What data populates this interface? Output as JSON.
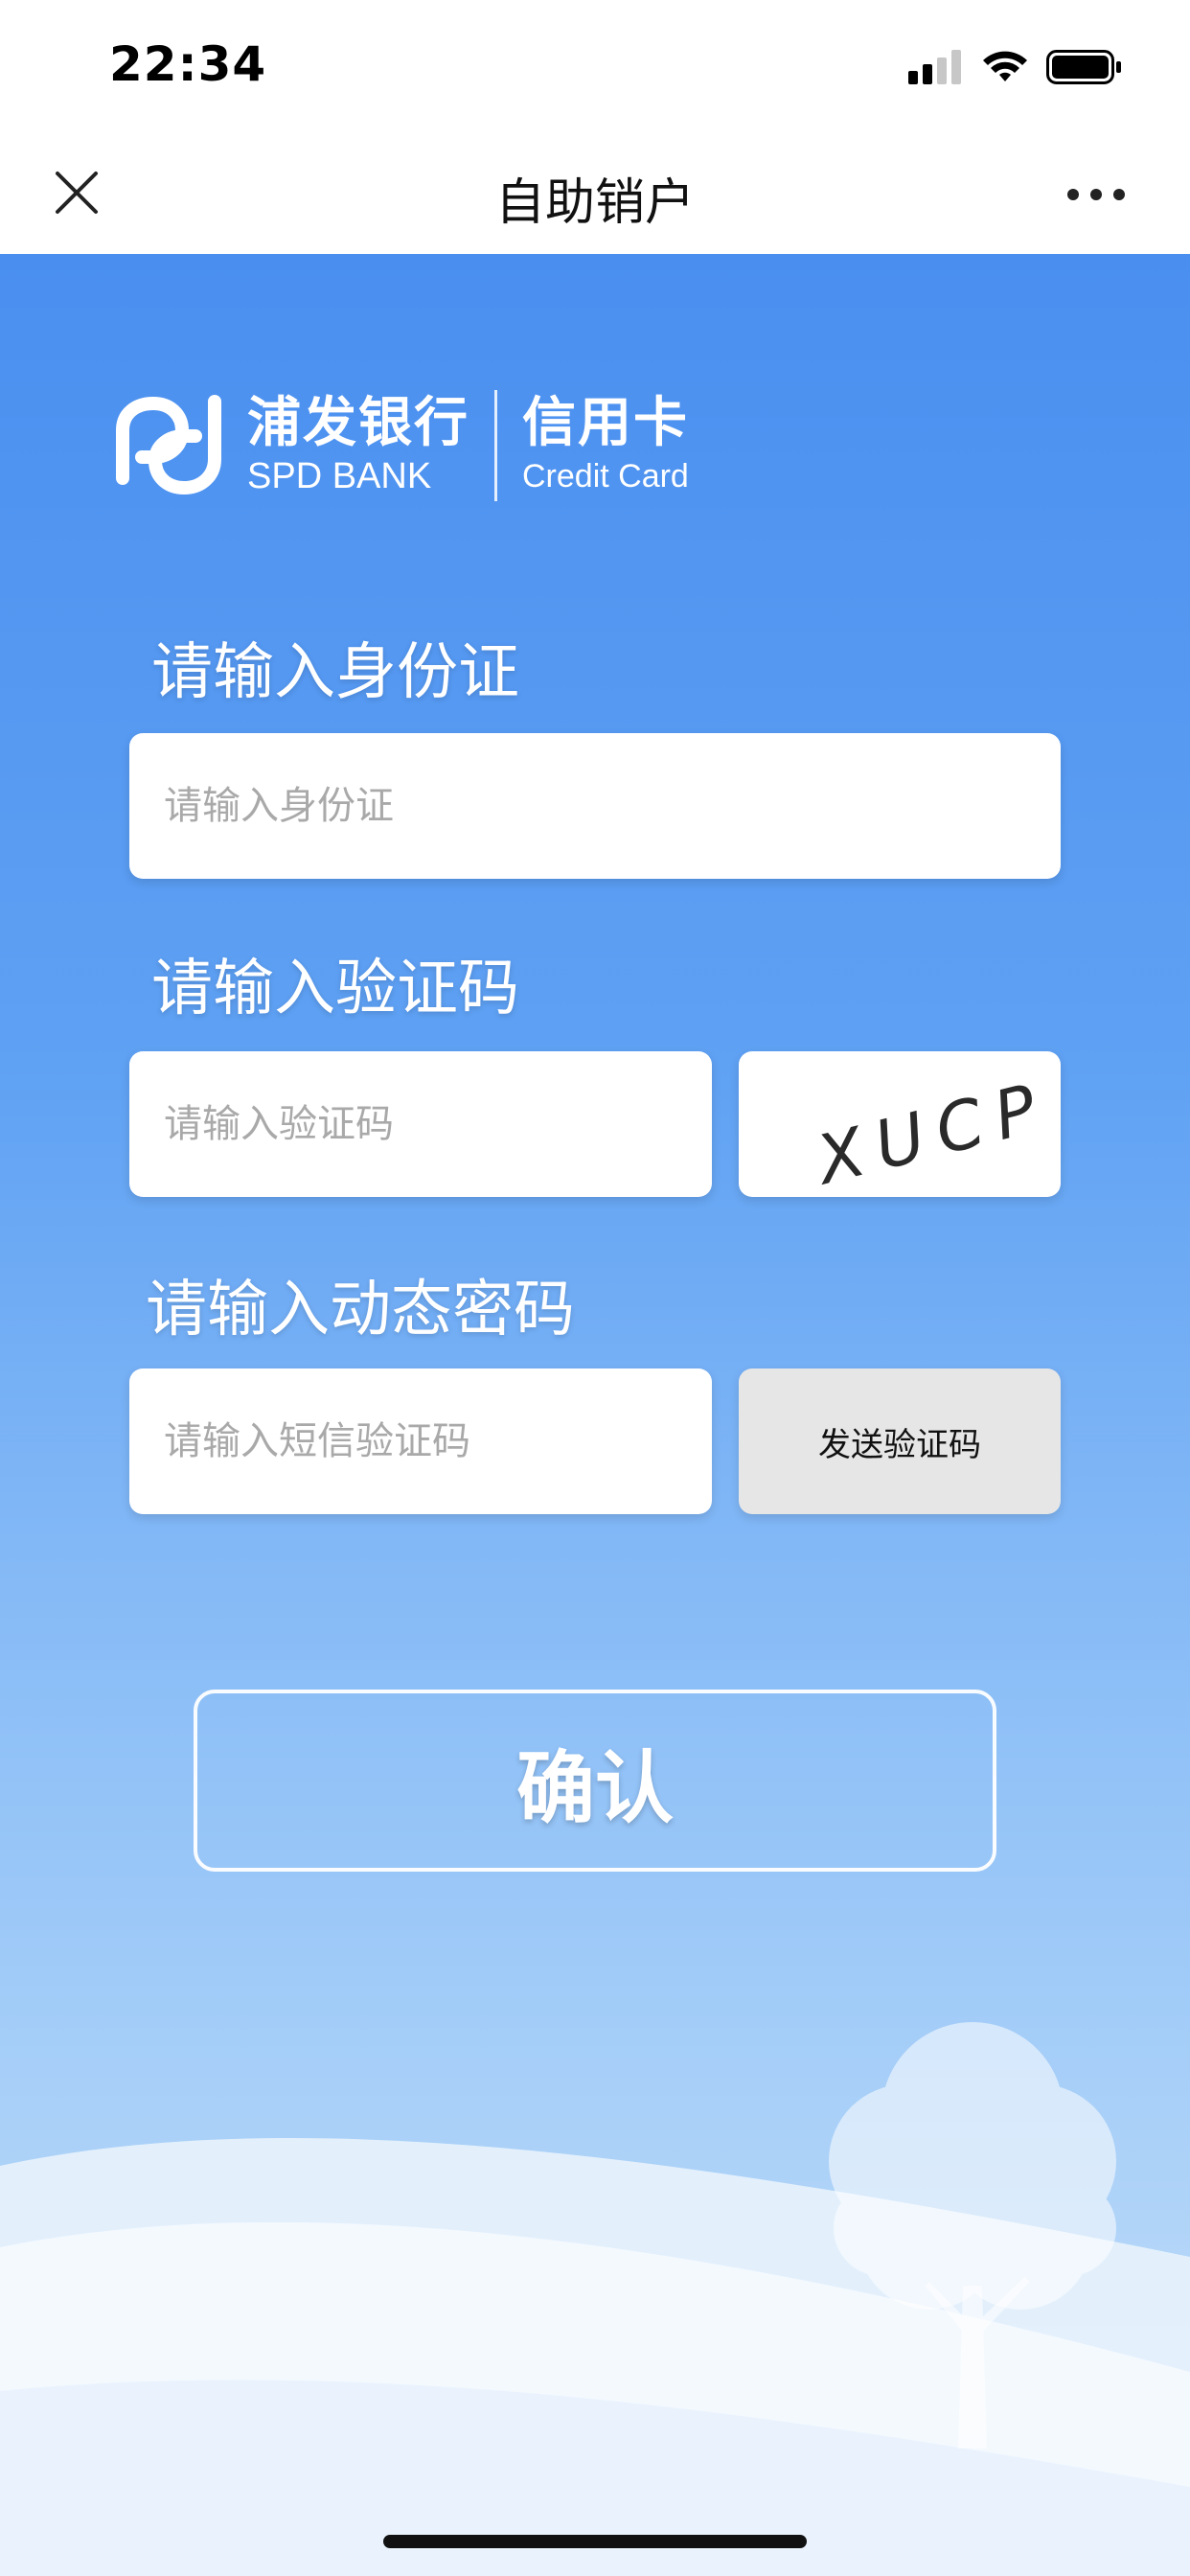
{
  "status_bar": {
    "time": "22:34"
  },
  "nav": {
    "title": "自助销户",
    "close_icon": "close-icon",
    "more_icon": "more-icon"
  },
  "logo": {
    "bank_cn": "浦发银行",
    "bank_en": "SPD BANK",
    "card_cn": "信用卡",
    "card_en": "Credit Card"
  },
  "form": {
    "id_label": "请输入身份证",
    "id_placeholder": "请输入身份证",
    "captcha_label": "请输入验证码",
    "captcha_placeholder": "请输入验证码",
    "captcha_text": "XUCP",
    "otp_label": "请输入动态密码",
    "otp_placeholder": "请输入短信验证码",
    "send_code_label": "发送验证码"
  },
  "actions": {
    "confirm_label": "确认"
  },
  "colors": {
    "primary_blue": "#4a8ff0",
    "white": "#ffffff",
    "send_button_bg": "#e6e6e6"
  }
}
